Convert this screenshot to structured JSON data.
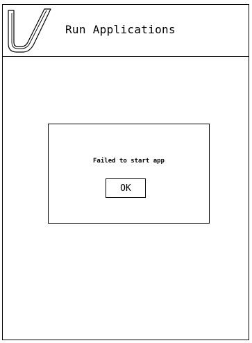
{
  "header": {
    "title": "Run Applications",
    "logo_icon": "v-logo-icon"
  },
  "dialog": {
    "message": "Failed to start app",
    "ok_label": "OK"
  },
  "colors": {
    "background": "#ffffff",
    "foreground": "#000000"
  }
}
